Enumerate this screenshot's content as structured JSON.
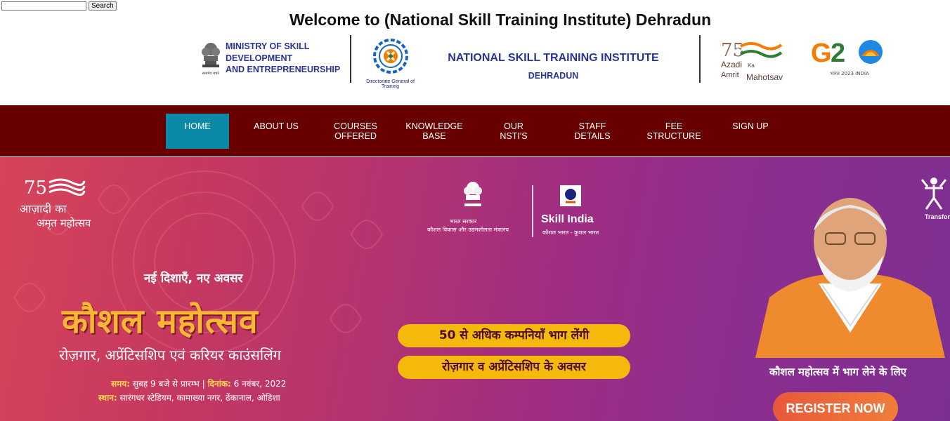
{
  "search": {
    "placeholder": "",
    "value": "",
    "button_label": "Search"
  },
  "header": {
    "title": "Welcome to (National Skill Training Institute) Dehradun",
    "emblem_caption": "सत्यमेव जयते",
    "ministry": [
      "MINISTRY OF SKILL",
      "DEVELOPMENT",
      "AND ENTREPRENEURSHIP"
    ],
    "dgt_label": "Directorate General of Training",
    "institute_name": "NATIONAL SKILL TRAINING INSTITUTE",
    "institute_city": "DEHRADUN",
    "azadi_logo": {
      "azadi": "Azadi",
      "ka": "Ka",
      "amrit": "Amrit",
      "mahotsav": "Mahotsav"
    },
    "g20_logo": {
      "text": "G20",
      "caption": "भारत 2023 INDIA"
    }
  },
  "nav": {
    "items": [
      {
        "label": "HOME",
        "active": true
      },
      {
        "label": "ABOUT US",
        "active": false
      },
      {
        "label": "COURSES OFFERED",
        "active": false
      },
      {
        "label": "KNOWLEDGE BASE",
        "active": false
      },
      {
        "label": "OUR NSTI'S",
        "active": false
      },
      {
        "label": "STAFF DETAILS",
        "active": false
      },
      {
        "label": "FEE STRUCTURE",
        "active": false
      },
      {
        "label": "SIGN UP",
        "active": false
      }
    ]
  },
  "banner": {
    "azadi_hindi_line1": "आज़ादी का",
    "azadi_hindi_line2": "अमृत महोत्सव",
    "gov_line1": "भारत सरकार",
    "gov_line2": "कौशल विकास और उद्यमशीलता मंत्रालय",
    "skill_india": "Skill India",
    "skill_india_tag": "कौशल भारत - कुशल भारत",
    "tagline": "नई दिशाएँ, नए अवसर",
    "event_title": "कौशल महोत्सव",
    "event_subtitle": "रोज़गार, अप्रेंटिसशिप एवं करियर काउंसलिंग",
    "time_label": "समय:",
    "time_value": "सुबह 9 बजे से प्रारम्भ",
    "date_label": "दिनांक:",
    "date_value": "6 नवंबर, 2022",
    "venue_label": "स्थान:",
    "venue_value": "सारंगधर स्टेडियम, कामाख्या नगर, ढेंकानाल, ओडिशा",
    "pill1": "50 से अधिक कम्पनियाँ भाग लेंगी",
    "pill2": "रोज़गार व अप्रेंटिसशिप के अवसर",
    "cta_caption": "कौशल महोत्सव में भाग लेने के लिए",
    "register_label": "REGISTER NOW",
    "transform_label": "Transfor"
  },
  "colors": {
    "nav_bg": "#690000",
    "nav_active": "#0b8aa8",
    "header_blue": "#283593",
    "pill_yellow": "#f5b90c",
    "register_orange": "#e8583a"
  }
}
